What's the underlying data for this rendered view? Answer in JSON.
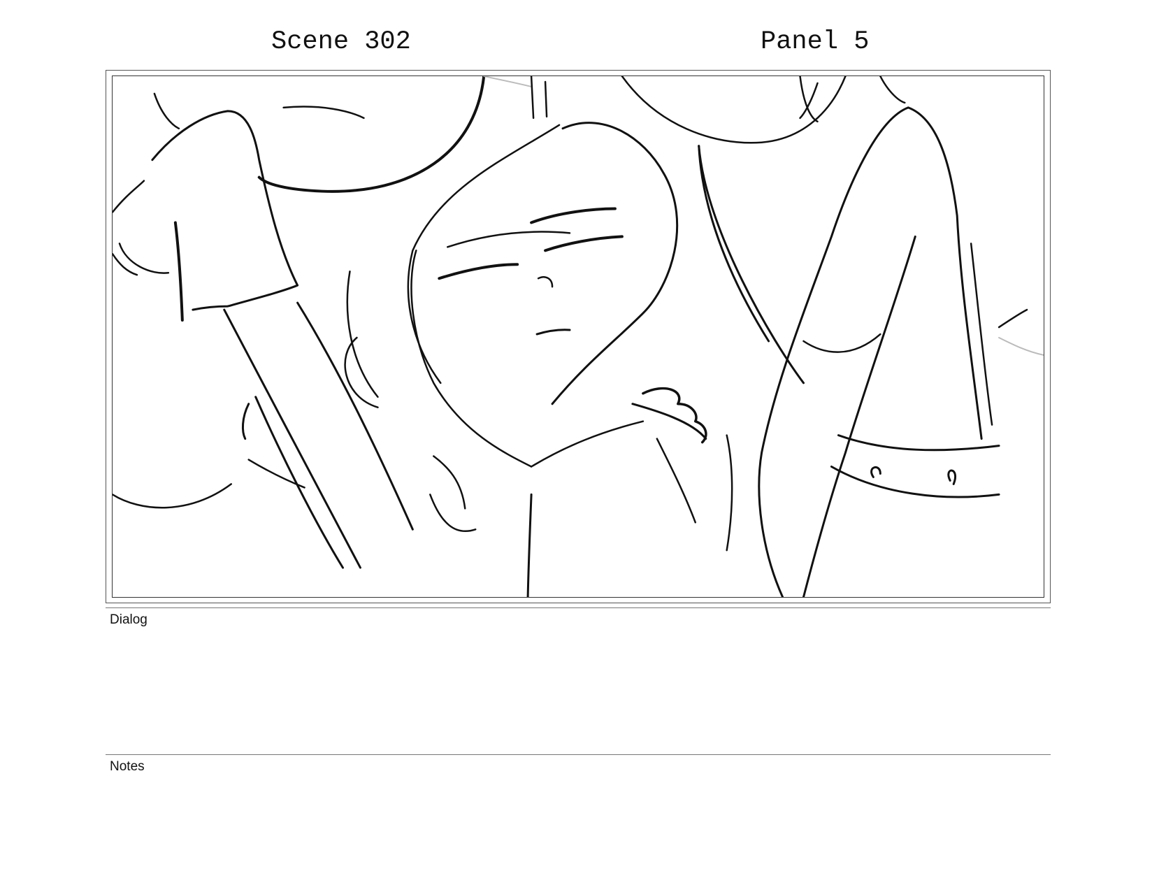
{
  "header": {
    "scene": "Scene 302",
    "panel": "Panel 5"
  },
  "sections": {
    "dialog_label": "Dialog",
    "dialog_text": "",
    "notes_label": "Notes",
    "notes_text": ""
  }
}
